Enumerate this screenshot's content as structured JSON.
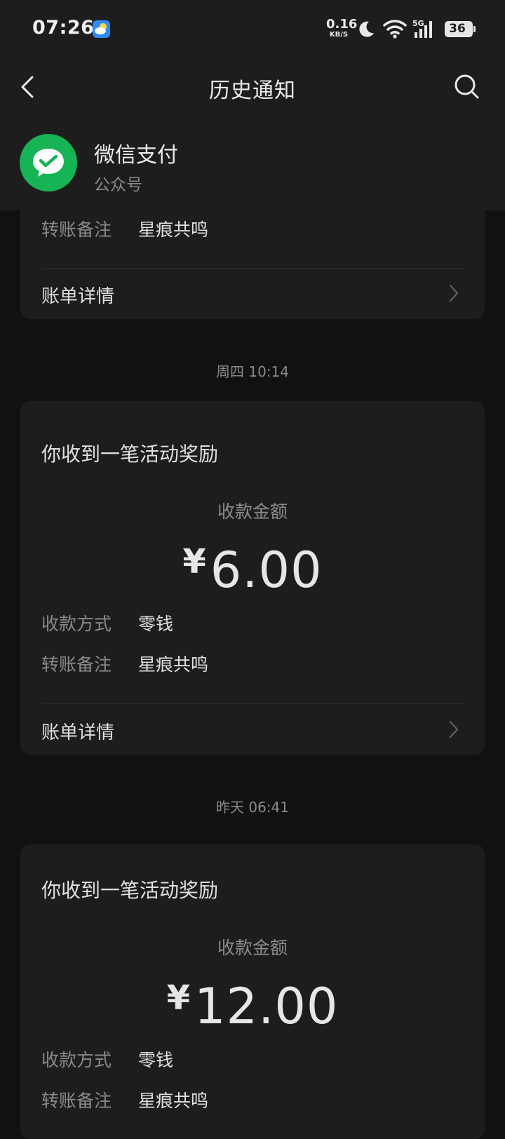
{
  "status_bar": {
    "time": "07:26",
    "net_speed_value": "0.16",
    "net_speed_unit": "KB/S",
    "battery": "36",
    "icons": [
      "weather-icon",
      "moon-icon",
      "wifi-icon",
      "5g-signal-icon",
      "battery-icon"
    ]
  },
  "nav": {
    "title": "历史通知",
    "account_name": "微信支付",
    "account_type": "公众号"
  },
  "top_card": {
    "remark_label": "转账备注",
    "remark_value": "星痕共鸣",
    "detail_link": "账单详情"
  },
  "messages": [
    {
      "timestamp": "周四 10:14",
      "title": "你收到一笔活动奖励",
      "amount_label": "收款金额",
      "currency": "¥",
      "amount": "6.00",
      "method_label": "收款方式",
      "method_value": "零钱",
      "remark_label": "转账备注",
      "remark_value": "星痕共鸣",
      "detail_link": "账单详情"
    },
    {
      "timestamp": "昨天 06:41",
      "title": "你收到一笔活动奖励",
      "amount_label": "收款金额",
      "currency": "¥",
      "amount": "12.00",
      "method_label": "收款方式",
      "method_value": "零钱",
      "remark_label": "转账备注",
      "remark_value": "星痕共鸣"
    }
  ],
  "colors": {
    "background": "#111111",
    "card": "#1d1d1d",
    "wechat_pay_green": "#16b455"
  }
}
